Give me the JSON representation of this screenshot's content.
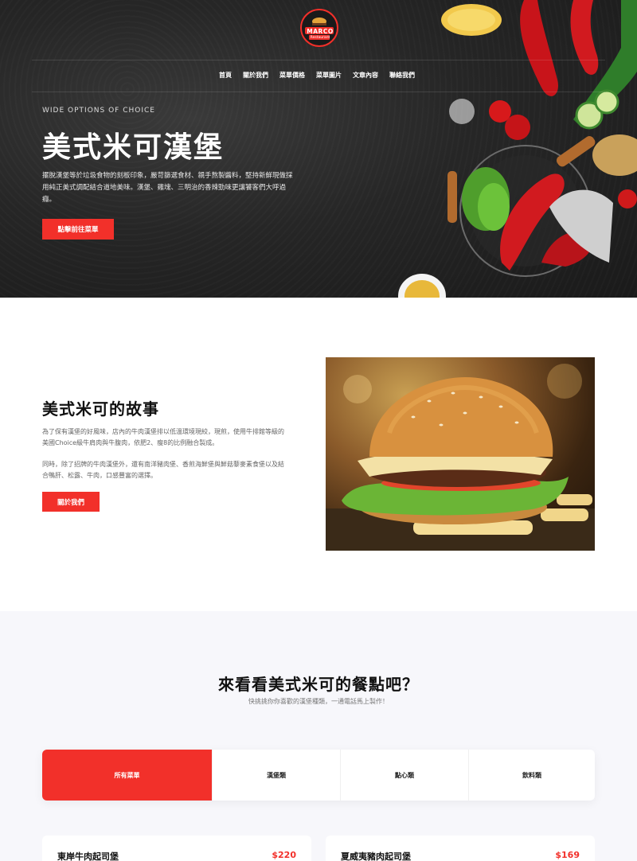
{
  "brand": {
    "logo_text": "MARCO",
    "logo_sub": "Restaurant",
    "accent": "#f2302a"
  },
  "nav": {
    "items": [
      {
        "label": "首頁"
      },
      {
        "label": "關於我們"
      },
      {
        "label": "菜單價格"
      },
      {
        "label": "菜單圖片"
      },
      {
        "label": "文章內容"
      },
      {
        "label": "聯絡我們"
      }
    ]
  },
  "hero": {
    "eyebrow": "WIDE OPTIONS OF CHOICE",
    "title": "美式米可漢堡",
    "description": "擺脫漢堡等於垃圾食物的刻板印象，嚴苛篩選食材、親手熬製醬料，堅持新鮮現做採用純正美式調配結合道地美味。漢堡、雞塊、三明治的香辣勁味更讓饕客們大呼過癮。",
    "cta_label": "點擊前往菜單"
  },
  "story": {
    "title": "美式米可的故事",
    "paragraph1": "為了保有漢堡的好風味，店內的牛肉漢堡排以低溫環境現絞，現煎，使用牛排館等級的美國Choice級牛肩肉與牛腹肉，依肥2、瘦8的比例融合製成。",
    "paragraph2": "同時，除了招牌的牛肉漢堡外，還有南洋豬肉堡、香煎海鮮堡與鮮菇藜麥素食堡以及結合鴨肝、松露、牛肉，口感豐富的選擇。",
    "button_label": "關於我們"
  },
  "menu": {
    "title": "來看看美式米可的餐點吧？",
    "subtitle": "快挑挑你你喜歡的漢堡種類，一通電話馬上製作！",
    "tabs": [
      {
        "label": "所有菜單",
        "active": true
      },
      {
        "label": "漢堡類",
        "active": false
      },
      {
        "label": "點心類",
        "active": false
      },
      {
        "label": "飲料類",
        "active": false
      }
    ],
    "items": [
      {
        "name": "東岸牛肉起司堡",
        "price": "$220"
      },
      {
        "name": "夏威夷豬肉起司堡",
        "price": "$169"
      }
    ]
  }
}
